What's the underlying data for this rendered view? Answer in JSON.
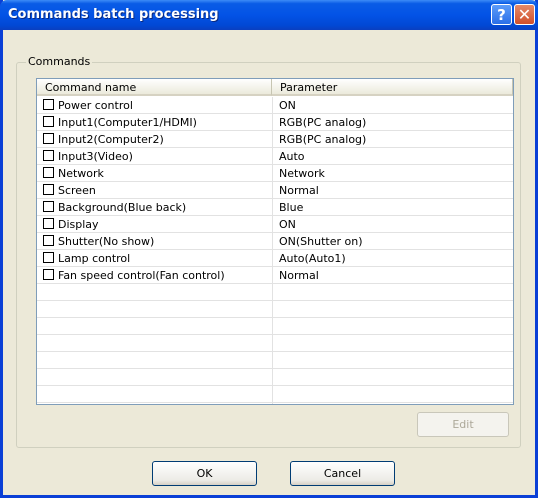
{
  "window": {
    "title": "Commands batch processing"
  },
  "titlebar": {
    "help_glyph": "?",
    "close_glyph": "✕",
    "help_icon": "help-icon",
    "close_icon": "close-icon"
  },
  "group": {
    "label": "Commands"
  },
  "list": {
    "columns": [
      "Command name",
      "Parameter"
    ],
    "rows": [
      {
        "name": "Power control",
        "param": "ON",
        "checked": false
      },
      {
        "name": "Input1(Computer1/HDMI)",
        "param": "RGB(PC analog)",
        "checked": false
      },
      {
        "name": "Input2(Computer2)",
        "param": "RGB(PC analog)",
        "checked": false
      },
      {
        "name": "Input3(Video)",
        "param": "Auto",
        "checked": false
      },
      {
        "name": "Network",
        "param": "Network",
        "checked": false
      },
      {
        "name": "Screen",
        "param": "Normal",
        "checked": false
      },
      {
        "name": "Background(Blue back)",
        "param": "Blue",
        "checked": false
      },
      {
        "name": "Display",
        "param": "ON",
        "checked": false
      },
      {
        "name": "Shutter(No show)",
        "param": "ON(Shutter on)",
        "checked": false
      },
      {
        "name": "Lamp control",
        "param": "Auto(Auto1)",
        "checked": false
      },
      {
        "name": "Fan speed control(Fan control)",
        "param": "Normal",
        "checked": false
      }
    ]
  },
  "buttons": {
    "edit": "Edit",
    "ok": "OK",
    "cancel": "Cancel"
  },
  "colors": {
    "titlebar": "#0353e6",
    "dialog_bg": "#ece9d8",
    "list_border": "#7f9db9"
  }
}
